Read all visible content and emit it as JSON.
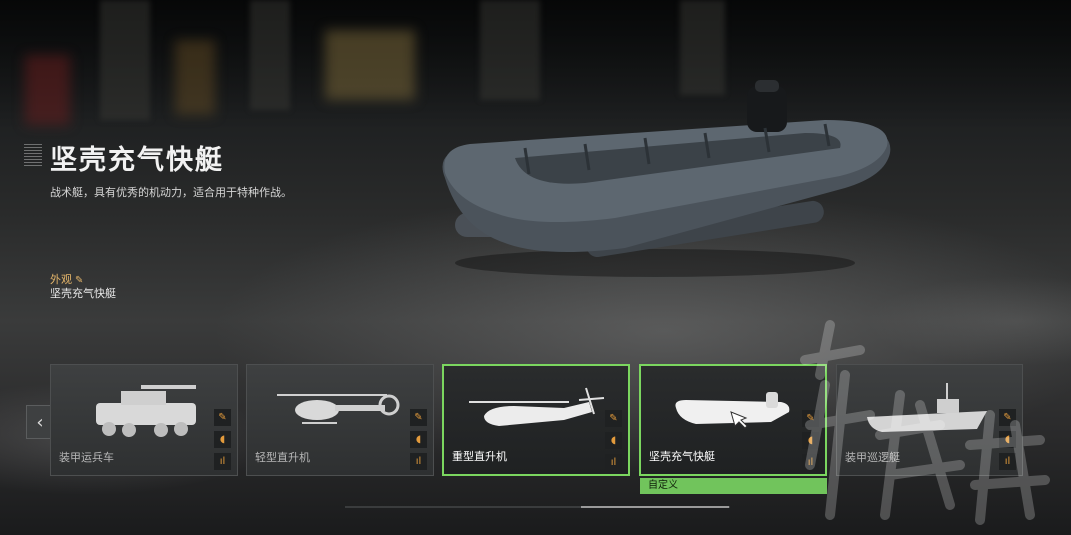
{
  "vehicle": {
    "title": "坚壳充气快艇",
    "description": "战术艇，具有优秀的机动力，适合用于特种作战。",
    "appearance_label": "外观",
    "appearance_value": "坚壳充气快艇"
  },
  "carousel": {
    "prev_icon": "‹",
    "cards": [
      {
        "name": "装甲运兵车",
        "icon": "apc-icon"
      },
      {
        "name": "轻型直升机",
        "icon": "light-helicopter-icon"
      },
      {
        "name": "重型直升机",
        "icon": "heavy-helicopter-icon"
      },
      {
        "name": "坚壳充气快艇",
        "icon": "rib-boat-icon"
      },
      {
        "name": "装甲巡逻艇",
        "icon": "patrol-boat-icon"
      }
    ],
    "selected_index": 3,
    "selected_tag": "自定义",
    "slot_icons": [
      "paint-brush-icon",
      "horn-icon",
      "engine-sound-icon"
    ]
  },
  "colors": {
    "accent_green": "#71c45c",
    "icon_orange": "#e39b3c",
    "label_gold": "#e4b56a"
  }
}
